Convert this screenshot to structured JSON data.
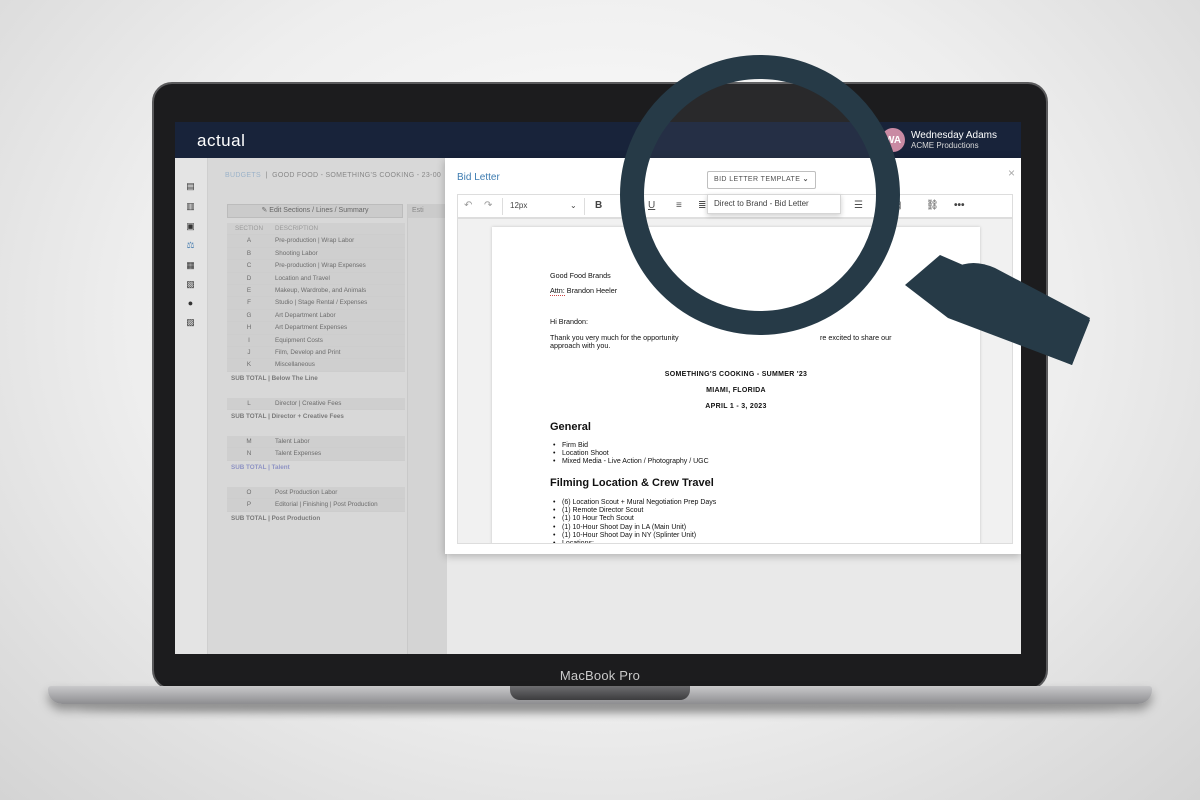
{
  "device": {
    "label": "MacBook Pro"
  },
  "app": {
    "logo": "actual",
    "user": {
      "initials": "WA",
      "name": "Wednesday Adams",
      "company": "ACME Productions"
    }
  },
  "sidebar_icons": [
    "dashboard-icon",
    "building-icon",
    "film-icon",
    "scale-icon",
    "document-icon",
    "file-icon",
    "users-icon",
    "bank-icon"
  ],
  "background": {
    "breadcrumb_root": "BUDGETS",
    "breadcrumb_sep": "|",
    "breadcrumb_project": "GOOD FOOD - SOMETHING'S COOKING - 23-00",
    "edit_button": "Edit Sections / Lines / Summary",
    "tab_partial": "Esti",
    "table_headers": {
      "section": "SECTION",
      "description": "DESCRIPTION"
    },
    "groups": [
      {
        "rows": [
          {
            "section": "A",
            "description": "Pre-production | Wrap Labor"
          },
          {
            "section": "B",
            "description": "Shooting Labor"
          },
          {
            "section": "C",
            "description": "Pre-production | Wrap Expenses"
          },
          {
            "section": "D",
            "description": "Location and Travel"
          },
          {
            "section": "E",
            "description": "Makeup, Wardrobe, and Animals"
          },
          {
            "section": "F",
            "description": "Studio | Stage Rental / Expenses"
          },
          {
            "section": "G",
            "description": "Art Department Labor"
          },
          {
            "section": "H",
            "description": "Art Department Expenses"
          },
          {
            "section": "I",
            "description": "Equipment Costs"
          },
          {
            "section": "J",
            "description": "Film, Develop and Print"
          },
          {
            "section": "K",
            "description": "Miscellaneous"
          }
        ],
        "subtotal": "SUB TOTAL | Below The Line"
      },
      {
        "rows": [
          {
            "section": "L",
            "description": "Director | Creative Fees"
          }
        ],
        "subtotal": "SUB TOTAL | Director + Creative Fees"
      },
      {
        "rows": [
          {
            "section": "M",
            "description": "Talent Labor"
          },
          {
            "section": "N",
            "description": "Talent Expenses"
          }
        ],
        "subtotal": "SUB TOTAL | Talent"
      },
      {
        "rows": [
          {
            "section": "O",
            "description": "Post Production Labor"
          },
          {
            "section": "P",
            "description": "Editorial | Finishing | Post Production"
          }
        ],
        "subtotal": "SUB TOTAL | Post Production"
      }
    ]
  },
  "modal": {
    "title": "Bid Letter",
    "template_select": "BID LETTER TEMPLATE",
    "template_option": "Direct to Brand - Bid Letter",
    "font_size": "12px",
    "close": "×"
  },
  "letter": {
    "company": "Good Food Brands",
    "attn_label": "Attn:",
    "attn_name": "Brandon Heeler",
    "greeting": "Hi Brandon:",
    "body_line1_a": "Thank you very much for the opportunity",
    "body_line1_b": "re excited to share our",
    "body_line2": "approach with you.",
    "project_title": "SOMETHING'S COOKING - SUMMER '23",
    "location": "MIAMI, FLORIDA",
    "dates": "APRIL 1 - 3, 2023",
    "general_heading": "General",
    "general_items": [
      "Firm Bid",
      "Location Shoot",
      "Mixed Media - Live Action / Photography / UGC"
    ],
    "filming_heading": "Filming Location & Crew Travel",
    "filming_items": [
      "(6) Location Scout + Mural Negotiation Prep Days",
      "(1) Remote Director Scout",
      "(1) 10 Hour Tech Scout",
      "(1) 10-Hour Shoot Day in LA (Main Unit)",
      "(1) 10-Hour Shoot Day in NY (Splinter Unit)",
      "Locations:"
    ]
  },
  "colors": {
    "topbar": "#18233a",
    "accent": "#3c7bb0",
    "magnifier": "#263a47"
  }
}
